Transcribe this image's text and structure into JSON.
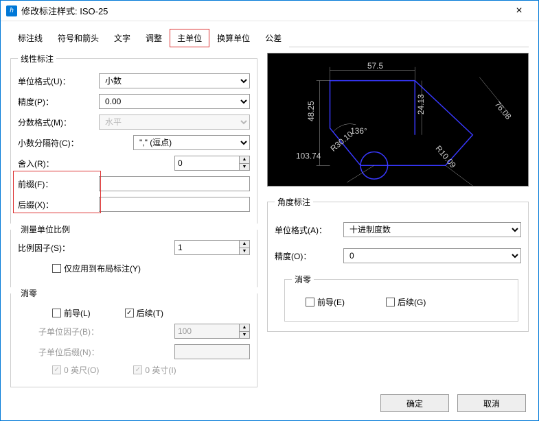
{
  "titlebar": {
    "title": "修改标注样式: ISO-25"
  },
  "tabs": [
    "标注线",
    "符号和箭头",
    "文字",
    "调整",
    "主单位",
    "换算单位",
    "公差"
  ],
  "active_tab_index": 4,
  "linear": {
    "legend": "线性标注",
    "unit_format_label": "单位格式(U)：",
    "unit_format_value": "小数",
    "precision_label": "精度(P)：",
    "precision_value": "0.00",
    "fraction_label": "分数格式(M)：",
    "fraction_value": "水平",
    "decimal_sep_label": "小数分隔符(C)：",
    "decimal_sep_value": "\",\" (逗点)",
    "round_label": "舍入(R)：",
    "round_value": "0",
    "prefix_label": "前缀(F)：",
    "prefix_value": "",
    "suffix_label": "后缀(X)：",
    "suffix_value": ""
  },
  "scale": {
    "legend": "测量单位比例",
    "factor_label": "比例因子(S)：",
    "factor_value": "1",
    "apply_layout_label": "仅应用到布局标注(Y)"
  },
  "zero": {
    "legend": "消零",
    "leading_label": "前导(L)",
    "trailing_label": "后续(T)",
    "subunit_factor_label": "子单位因子(B)：",
    "subunit_factor_value": "100",
    "subunit_suffix_label": "子单位后缀(N)：",
    "subunit_suffix_value": "",
    "zero_feet_label": "0 英尺(O)",
    "zero_inch_label": "0 英寸(I)"
  },
  "angular": {
    "legend": "角度标注",
    "unit_format_label": "单位格式(A)：",
    "unit_format_value": "十进制度数",
    "precision_label": "精度(O)：",
    "precision_value": "0",
    "zero_legend": "消零",
    "leading_label": "前导(E)",
    "trailing_label": "后续(G)"
  },
  "preview_labels": {
    "top": "57.5",
    "left": "48.25",
    "mid_v": "24.13",
    "angle": "136°",
    "r": "R30.10",
    "slope": "R10.09",
    "right": "76.08",
    "bl": "103.74"
  },
  "buttons": {
    "ok": "确定",
    "cancel": "取消"
  }
}
